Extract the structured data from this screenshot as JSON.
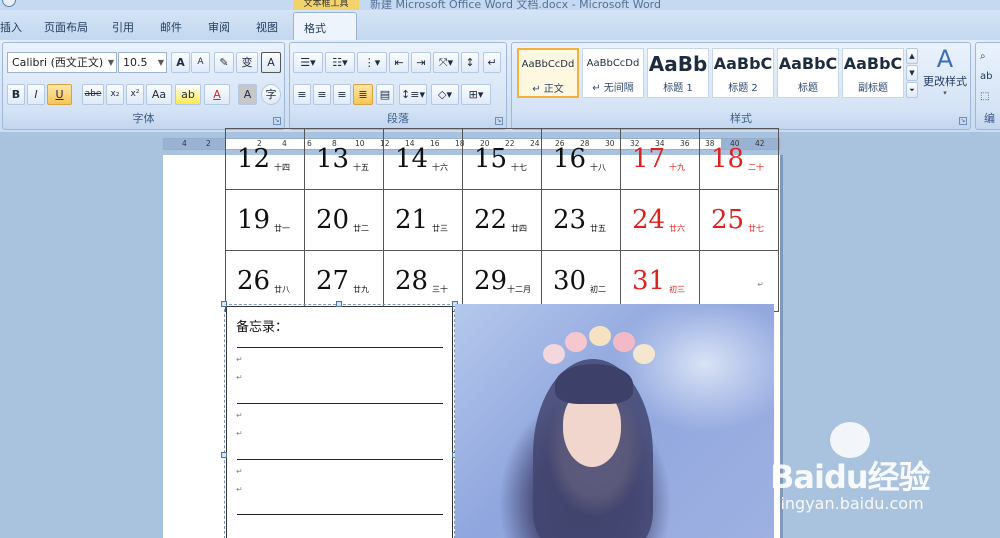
{
  "window": {
    "title": "新建 Microsoft Office Word 文档.docx - Microsoft Word",
    "contextual_tab": "文本框工具"
  },
  "tabs": [
    "插入",
    "页面布局",
    "引用",
    "邮件",
    "审阅",
    "视图",
    "格式"
  ],
  "active_tab": "格式",
  "ribbon": {
    "font": {
      "label": "字体",
      "font_name": "Calibri (西文正文)",
      "font_size": "10.5",
      "grow": "A",
      "shrink": "A",
      "phonetic": "变",
      "border": "A",
      "bold": "B",
      "italic": "I",
      "underline": "U",
      "strike": "abe",
      "subscript": "x₂",
      "superscript": "x²",
      "case": "Aa",
      "highlight": "ab",
      "font_color": "A",
      "shading": "A",
      "enclose": "字"
    },
    "paragraph": {
      "label": "段落"
    },
    "styles": {
      "label": "样式",
      "items": [
        {
          "preview": "AaBbCcDd",
          "label": "↵ 正文"
        },
        {
          "preview": "AaBbCcDd",
          "label": "↵ 无间隔"
        },
        {
          "preview": "AaBb",
          "label": "标题 1"
        },
        {
          "preview": "AaBbC",
          "label": "标题 2"
        },
        {
          "preview": "AaBbC",
          "label": "标题"
        },
        {
          "preview": "AaBbC",
          "label": "副标题"
        }
      ],
      "change_styles": "更改样式"
    },
    "editing": {
      "label": "编"
    }
  },
  "ruler": {
    "ticks": [
      "4",
      "2",
      "2",
      "4",
      "6",
      "8",
      "10",
      "12",
      "14",
      "16",
      "18",
      "20",
      "22",
      "24",
      "26",
      "28",
      "30",
      "32",
      "34",
      "36",
      "38",
      "40",
      "42"
    ]
  },
  "calendar": {
    "weeks": [
      [
        {
          "d": "12",
          "l": "十四"
        },
        {
          "d": "13",
          "l": "十五"
        },
        {
          "d": "14",
          "l": "十六"
        },
        {
          "d": "15",
          "l": "十七"
        },
        {
          "d": "16",
          "l": "十八"
        },
        {
          "d": "17",
          "l": "十九",
          "red": true
        },
        {
          "d": "18",
          "l": "二十",
          "red": true
        }
      ],
      [
        {
          "d": "19",
          "l": "廿一"
        },
        {
          "d": "20",
          "l": "廿二"
        },
        {
          "d": "21",
          "l": "廿三"
        },
        {
          "d": "22",
          "l": "廿四"
        },
        {
          "d": "23",
          "l": "廿五"
        },
        {
          "d": "24",
          "l": "廿六",
          "red": true
        },
        {
          "d": "25",
          "l": "廿七",
          "red": true
        }
      ],
      [
        {
          "d": "26",
          "l": "廿八"
        },
        {
          "d": "27",
          "l": "廿九"
        },
        {
          "d": "28",
          "l": "三十"
        },
        {
          "d": "29",
          "l": "十二月"
        },
        {
          "d": "30",
          "l": "初二"
        },
        {
          "d": "31",
          "l": "初三",
          "red": true
        },
        {
          "d": "",
          "l": ""
        }
      ]
    ]
  },
  "memo": {
    "title": "备忘录：",
    "mark": "↵"
  },
  "watermark": {
    "brand": "Baidu经验",
    "url": "jingyan.baidu.com"
  },
  "colors": {
    "weekend_red": "#dd2222",
    "ribbon_bg": "#dbe7f6",
    "page_bg": "#a9c2de"
  }
}
